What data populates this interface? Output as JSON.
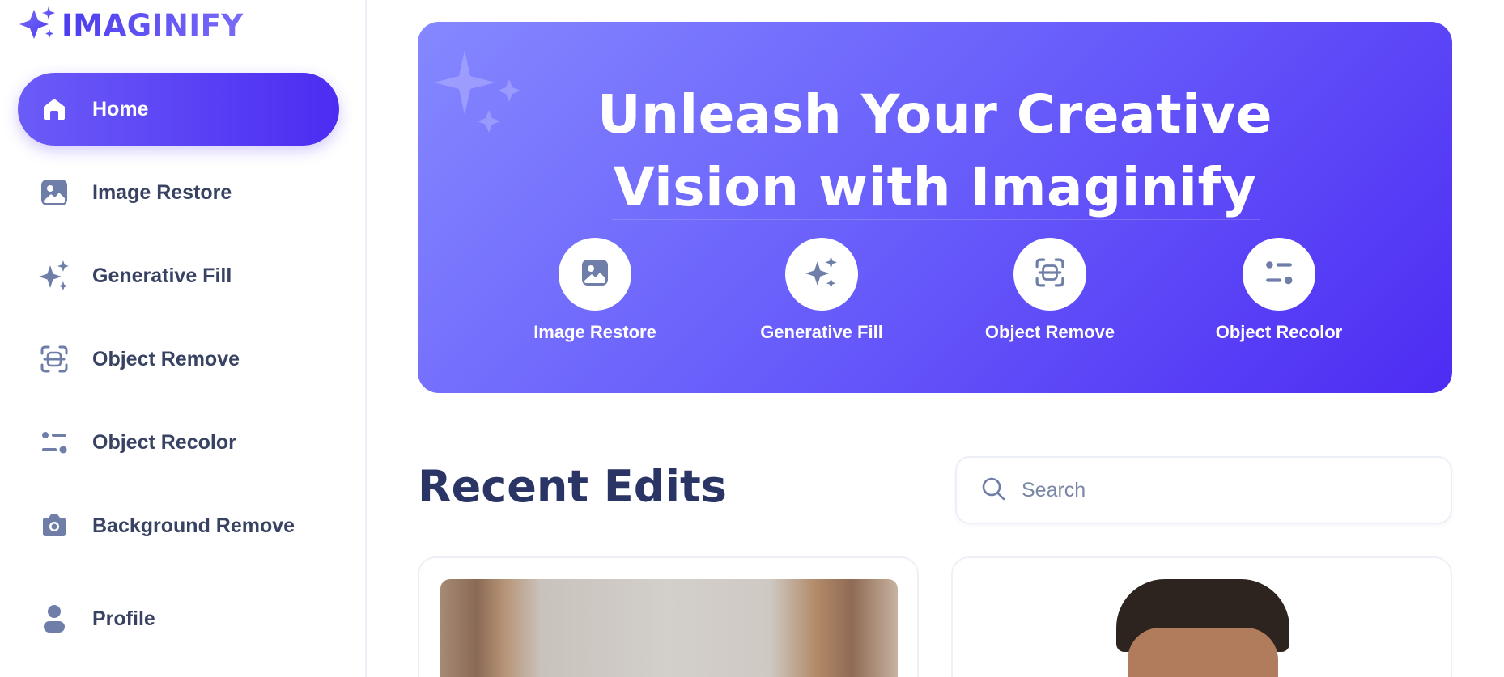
{
  "brand": {
    "name": "IMAGINIFY"
  },
  "sidebar": {
    "items": [
      {
        "label": "Home",
        "icon": "home-icon",
        "active": true
      },
      {
        "label": "Image Restore",
        "icon": "image-icon",
        "active": false
      },
      {
        "label": "Generative Fill",
        "icon": "stars-icon",
        "active": false
      },
      {
        "label": "Object Remove",
        "icon": "scan-icon",
        "active": false
      },
      {
        "label": "Object Recolor",
        "icon": "filter-icon",
        "active": false
      },
      {
        "label": "Background Remove",
        "icon": "camera-icon",
        "active": false
      },
      {
        "label": "Profile",
        "icon": "user-icon",
        "active": false
      }
    ]
  },
  "hero": {
    "title_line1": "Unleash Your Creative",
    "title_line2": "Vision with Imaginify",
    "tools": [
      {
        "label": "Image Restore",
        "icon": "image-icon"
      },
      {
        "label": "Generative Fill",
        "icon": "stars-icon"
      },
      {
        "label": "Object Remove",
        "icon": "scan-icon"
      },
      {
        "label": "Object Recolor",
        "icon": "filter-icon"
      }
    ]
  },
  "recent": {
    "title": "Recent Edits",
    "search_placeholder": "Search"
  },
  "colors": {
    "accent": "#4c2cf2",
    "accent_light": "#8588ff",
    "text": "#384262",
    "heading": "#2a3566",
    "icon": "#6e7ea8"
  }
}
